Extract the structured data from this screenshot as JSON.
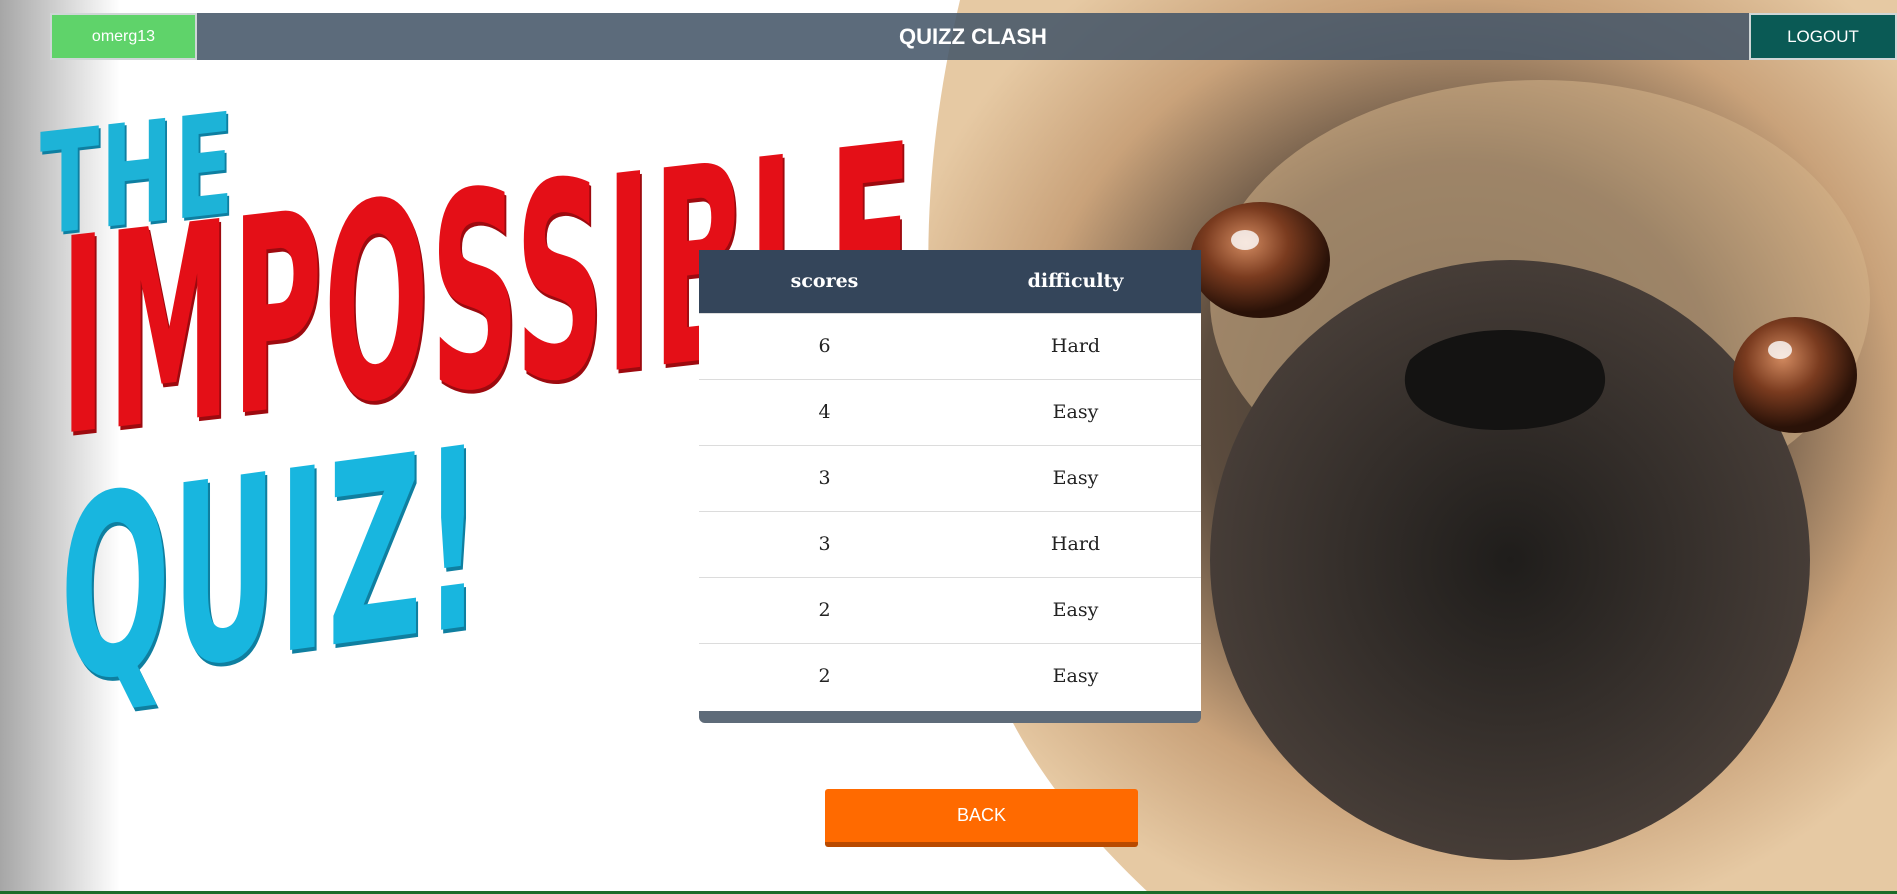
{
  "header": {
    "username": "omerg13",
    "app_title": "QUIZZ CLASH",
    "logout_label": "LOGOUT"
  },
  "hero": {
    "word_the": "THE",
    "word_impossible": "IMPOSSIBLE",
    "word_quiz": "QUIZ!"
  },
  "scores_table": {
    "columns": [
      "scores",
      "difficulty"
    ],
    "rows": [
      {
        "score": "6",
        "difficulty": "Hard"
      },
      {
        "score": "4",
        "difficulty": "Easy"
      },
      {
        "score": "3",
        "difficulty": "Easy"
      },
      {
        "score": "3",
        "difficulty": "Hard"
      },
      {
        "score": "2",
        "difficulty": "Easy"
      },
      {
        "score": "2",
        "difficulty": "Easy"
      }
    ]
  },
  "actions": {
    "back_label": "BACK"
  },
  "colors": {
    "user_button": "#5fd36a",
    "logout_button": "#0a5a55",
    "back_button": "#ff6a00",
    "table_header": "#34455a"
  }
}
